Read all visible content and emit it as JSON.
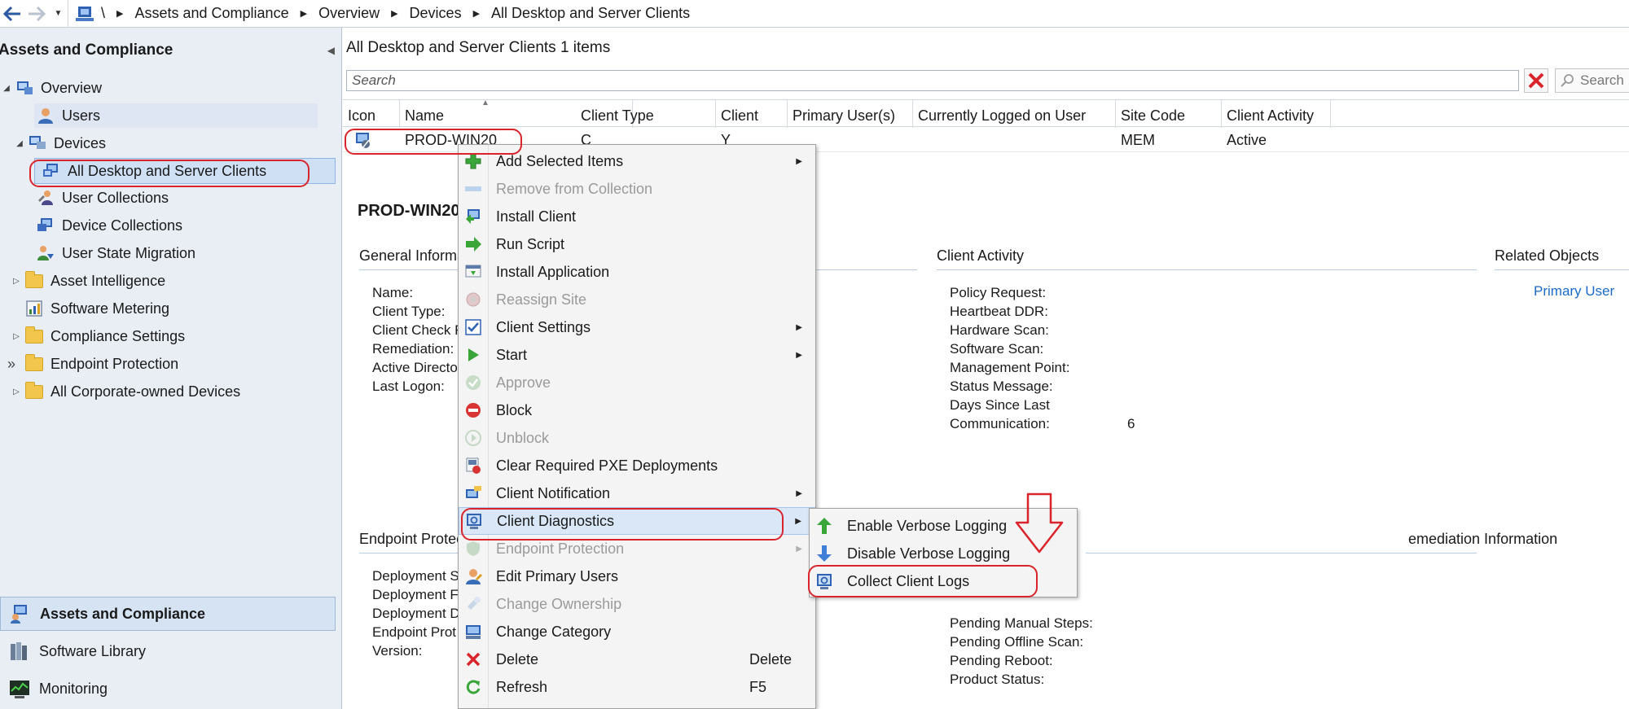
{
  "breadcrumb": {
    "root": "\\",
    "items": [
      "Assets and Compliance",
      "Overview",
      "Devices",
      "All Desktop and Server Clients"
    ]
  },
  "nav": {
    "header": "Assets and Compliance",
    "tree": [
      {
        "label": "Overview",
        "icon": "overview-icon"
      },
      {
        "label": "Users",
        "icon": "users-icon"
      },
      {
        "label": "Devices",
        "icon": "devices-icon"
      },
      {
        "label": "All Desktop and Server Clients",
        "icon": "device-collection-icon"
      },
      {
        "label": "User Collections",
        "icon": "user-collections-icon"
      },
      {
        "label": "Device Collections",
        "icon": "device-collections-icon"
      },
      {
        "label": "User State Migration",
        "icon": "user-state-migration-icon"
      },
      {
        "label": "Asset Intelligence",
        "icon": "folder-icon"
      },
      {
        "label": "Software Metering",
        "icon": "software-metering-icon"
      },
      {
        "label": "Compliance Settings",
        "icon": "folder-icon"
      },
      {
        "label": "Endpoint Protection",
        "icon": "folder-icon"
      },
      {
        "label": "All Corporate-owned Devices",
        "icon": "folder-icon"
      }
    ],
    "workspaces": [
      "Assets and Compliance",
      "Software Library",
      "Monitoring"
    ]
  },
  "list": {
    "title": "All Desktop and Server Clients",
    "count": "1 items",
    "search_placeholder": "Search",
    "search_button": "Search",
    "columns": [
      "Icon",
      "Name",
      "Client Type",
      "Client",
      "Primary User(s)",
      "Currently Logged on User",
      "Site Code",
      "Client Activity"
    ],
    "rows": [
      {
        "name": "PROD-WIN20",
        "client_type": "C",
        "client": "Y",
        "site_code": "MEM",
        "client_activity": "Active"
      }
    ]
  },
  "details": {
    "title": "PROD-WIN20",
    "general_header": "General Informa",
    "general_labels": [
      "Name:",
      "Client Type:",
      "Client Check R",
      "Remediation:",
      "Active Directo",
      "Last Logon:"
    ],
    "activity_header": "Client Activity",
    "activity_labels": [
      "Policy Request:",
      "Heartbeat DDR:",
      "Hardware Scan:",
      "Software Scan:",
      "Management Point:",
      "Status Message:",
      "Days Since Last",
      "Communication:"
    ],
    "days_since_value": "6",
    "related_header": "Related Objects",
    "related_link": "Primary User",
    "ep_header": "Endpoint Protec",
    "ep_labels": [
      "Deployment S",
      "Deployment F",
      "Deployment D",
      "Endpoint Prot",
      "Version:"
    ],
    "remediation_header": "emediation Information",
    "remediation_labels": [
      "Pending Manual Steps:",
      "Pending Offline Scan:",
      "Pending Reboot:",
      "Product Status:"
    ]
  },
  "context_menu": {
    "items": [
      {
        "label": "Add Selected Items",
        "submenu": true
      },
      {
        "label": "Remove from Collection",
        "disabled": true
      },
      {
        "label": "Install Client"
      },
      {
        "label": "Run Script"
      },
      {
        "label": "Install Application"
      },
      {
        "label": "Reassign Site",
        "disabled": true
      },
      {
        "label": "Client Settings",
        "submenu": true
      },
      {
        "label": "Start",
        "submenu": true
      },
      {
        "label": "Approve",
        "disabled": true
      },
      {
        "label": "Block"
      },
      {
        "label": "Unblock",
        "disabled": true
      },
      {
        "label": "Clear Required PXE Deployments"
      },
      {
        "label": "Client Notification",
        "submenu": true
      },
      {
        "label": "Client Diagnostics",
        "submenu": true,
        "highlighted": true
      },
      {
        "label": "Endpoint Protection",
        "submenu": true,
        "disabled": true
      },
      {
        "label": "Edit Primary Users"
      },
      {
        "label": "Change Ownership",
        "disabled": true
      },
      {
        "label": "Change Category"
      },
      {
        "label": "Delete",
        "shortcut": "Delete"
      },
      {
        "label": "Refresh",
        "shortcut": "F5"
      }
    ]
  },
  "sub_menu": {
    "items": [
      "Enable Verbose Logging",
      "Disable Verbose Logging",
      "Collect Client Logs"
    ]
  },
  "colors": {
    "annotation_red": "#d9242b",
    "nav_bg": "#e9eef5",
    "link_blue": "#1b6ac9"
  }
}
